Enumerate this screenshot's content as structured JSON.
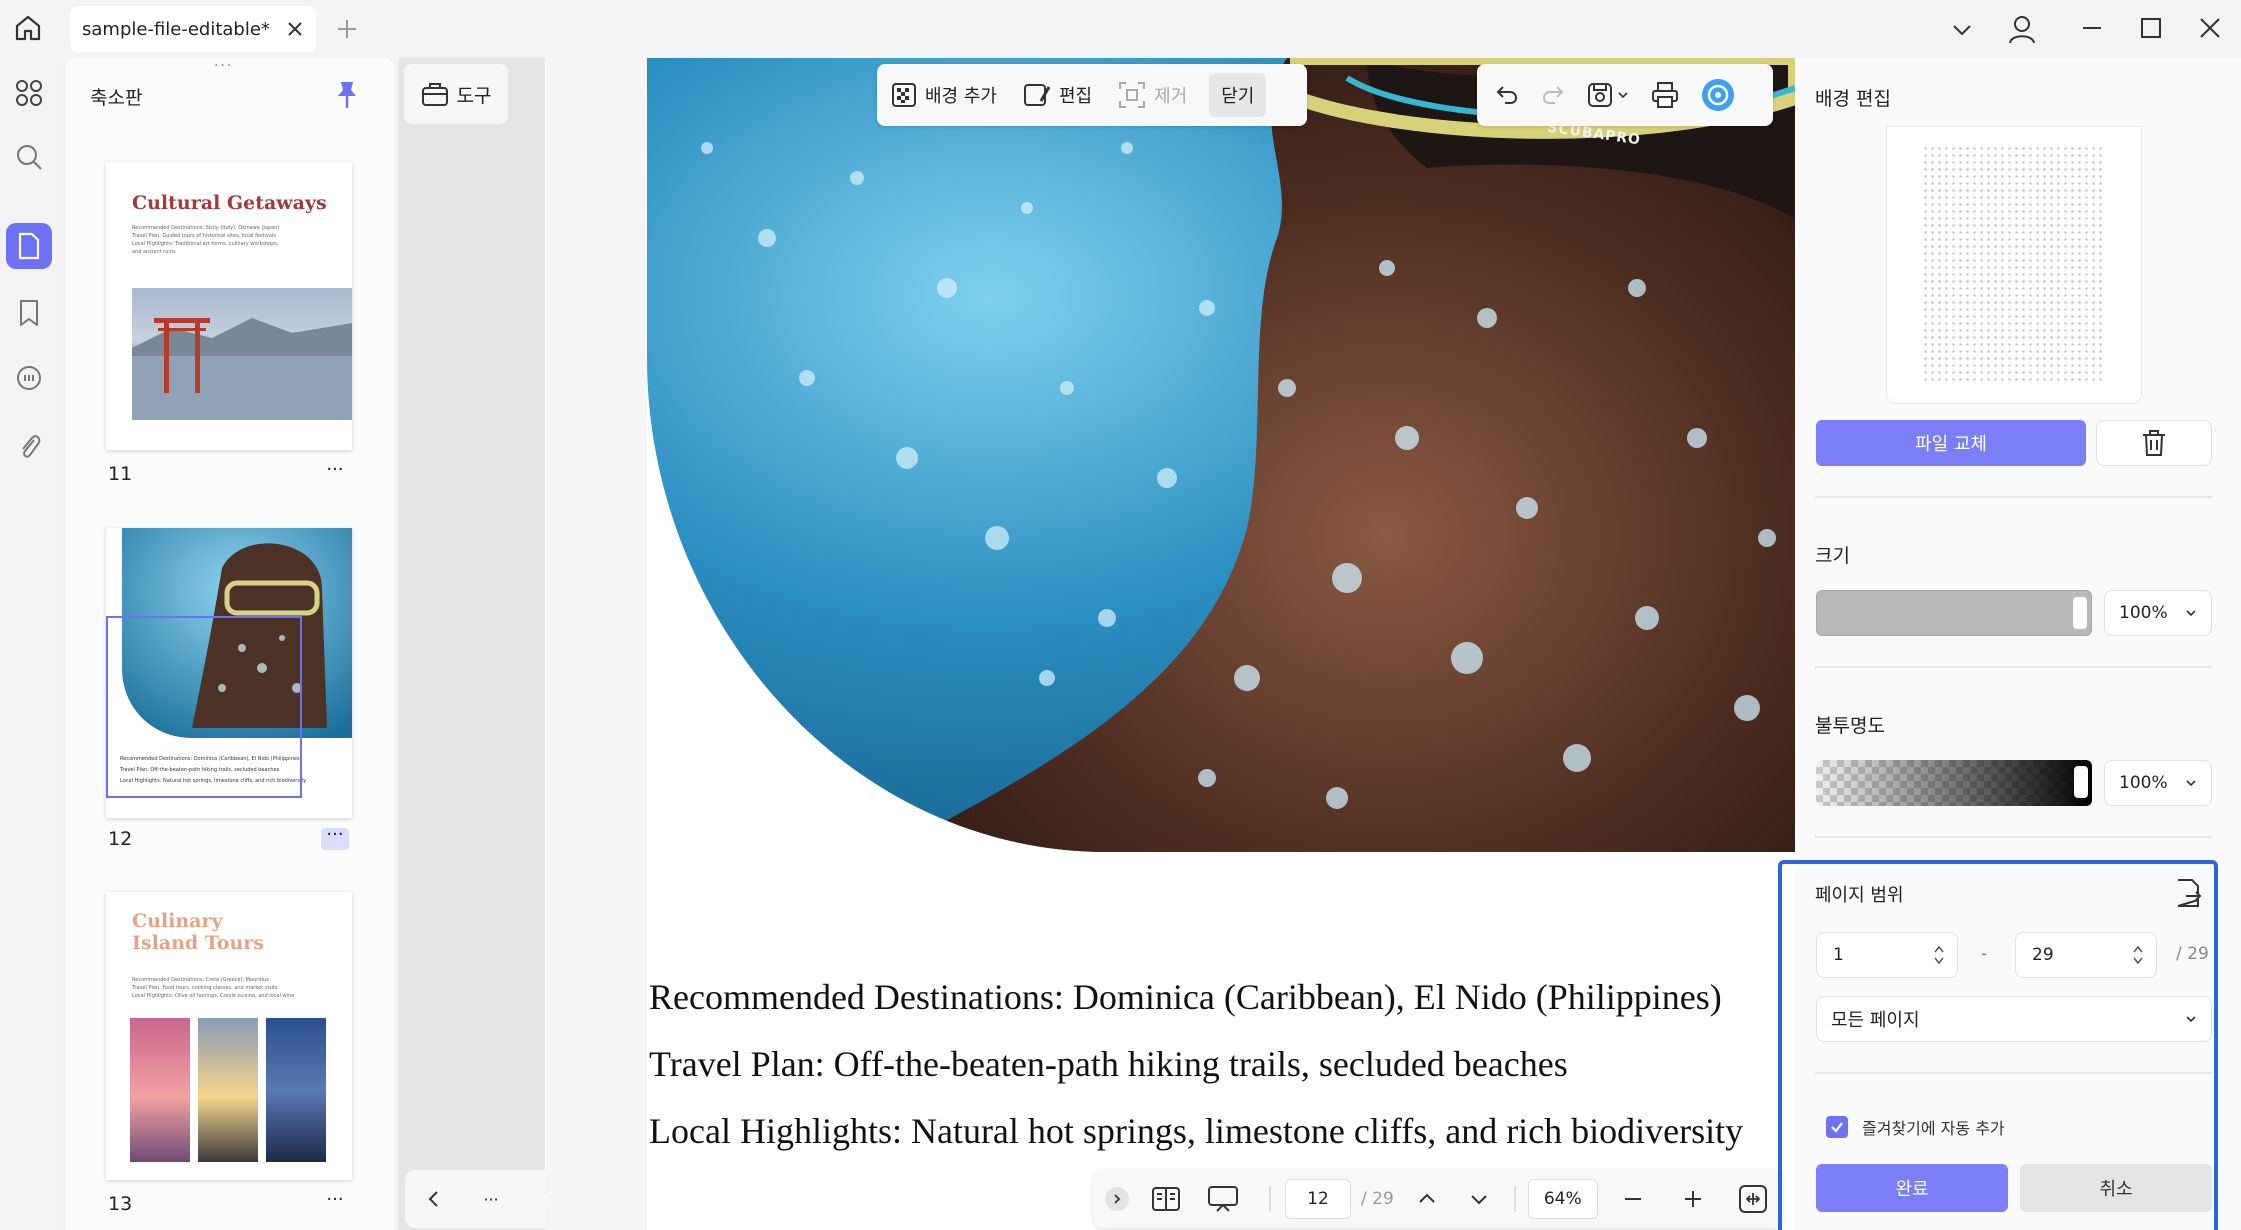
{
  "titlebar": {
    "tab_title": "sample-file-editable*"
  },
  "thumbnails": {
    "title": "축소판",
    "pages": [
      {
        "number": "11",
        "heading": "Cultural Getaways",
        "lines": [
          "Recommended Destinations: Sicily (Italy), Okinawa (Japan)",
          "Travel Plan: Guided tours of historical sites, local festivals",
          "Local Highlights: Traditional art forms, culinary workshops,",
          "and ancient ruins"
        ]
      },
      {
        "number": "12",
        "lines": [
          "Recommended Destinations: Dominica (Caribbean), El Nido (Philippines)",
          "Travel Plan: Off-the-beaten-path hiking trails, secluded beaches",
          "Local Highlights: Natural hot springs, limestone cliffs, and rich biodiversity"
        ]
      },
      {
        "number": "13",
        "heading_line1": "Culinary",
        "heading_line2": "Island Tours",
        "lines": [
          "Recommended Destinations: Crete (Greece), Mauritius",
          "Travel Plan: Food tours, cooking classes, and market visits",
          "Local Highlights: Olive oil tastings, Creole cuisine, and local wine"
        ]
      }
    ]
  },
  "tools": {
    "label": "도구"
  },
  "toolbar": {
    "add_bg": "배경 추가",
    "edit": "편집",
    "remove": "제거",
    "close": "닫기"
  },
  "document": {
    "mask_text": "SCUBAPRO",
    "lines": [
      "Recommended Destinations: Dominica (Caribbean), El Nido (Philippines)",
      "Travel Plan: Off-the-beaten-path hiking trails, secluded beaches",
      "Local Highlights: Natural hot springs, limestone cliffs, and rich biodiversity"
    ]
  },
  "bottombar": {
    "page": "12",
    "total": "/ 29",
    "zoom": "64%"
  },
  "rightpanel": {
    "title": "배경 편집",
    "replace_file": "파일 교체",
    "size_label": "크기",
    "size_value": "100%",
    "opacity_label": "불투명도",
    "opacity_value": "100%",
    "page_range_label": "페이지 범위",
    "range_from": "1",
    "range_dash": "-",
    "range_to": "29",
    "range_total": "/ 29",
    "pages_select": "모든 페이지",
    "bookmark_checkbox": "즐겨찾기에 자동 추가",
    "done": "완료",
    "cancel": "취소"
  },
  "colors": {
    "accent": "#7b7ff7",
    "highlight_border": "#2f64e0"
  }
}
